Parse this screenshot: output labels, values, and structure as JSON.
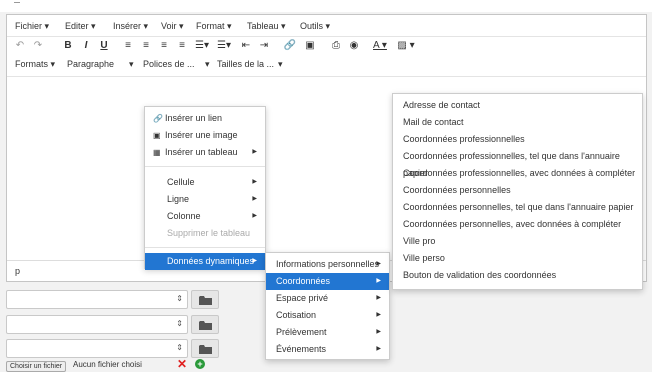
{
  "menubar": [
    "Fichier ▾",
    "Editer ▾",
    "Insérer ▾",
    "Voir ▾",
    "Format ▾",
    "Tableau ▾",
    "Outils ▾"
  ],
  "toolbar_formats": [
    "Formats ▾",
    "Paragraphe",
    "▾",
    "Polices de ...",
    "▾",
    "Tailles de la ...",
    "▾"
  ],
  "statusbar_path": "p",
  "context_menu": {
    "insert_link": "Insérer un lien",
    "insert_image": "Insérer une image",
    "insert_table": "Insérer un tableau",
    "cell": "Cellule",
    "row": "Ligne",
    "column": "Colonne",
    "delete_table": "Supprimer le tableau",
    "dynamic_data": "Données dynamiques"
  },
  "submenu1": [
    "Informations personnelles",
    "Coordonnées",
    "Espace privé",
    "Cotisation",
    "Prélèvement",
    "Événements"
  ],
  "submenu2": [
    "Adresse de contact",
    "Mail de contact",
    "Coordonnées professionnelles",
    "Coordonnées professionnelles, tel que dans l'annuaire papier",
    "Coordonnées professionnelles, avec données à compléter",
    "Coordonnées personnelles",
    "Coordonnées personnelles, tel que dans l'annuaire papier",
    "Coordonnées personnelles, avec données à compléter",
    "Ville pro",
    "Ville perso",
    "Bouton de validation des coordonnées"
  ],
  "file_input": {
    "button": "Choisir un fichier",
    "status": "Aucun fichier choisi"
  },
  "colors": {
    "accent": "#2276d2",
    "delete": "#e02020",
    "add": "#2a9a3a"
  }
}
